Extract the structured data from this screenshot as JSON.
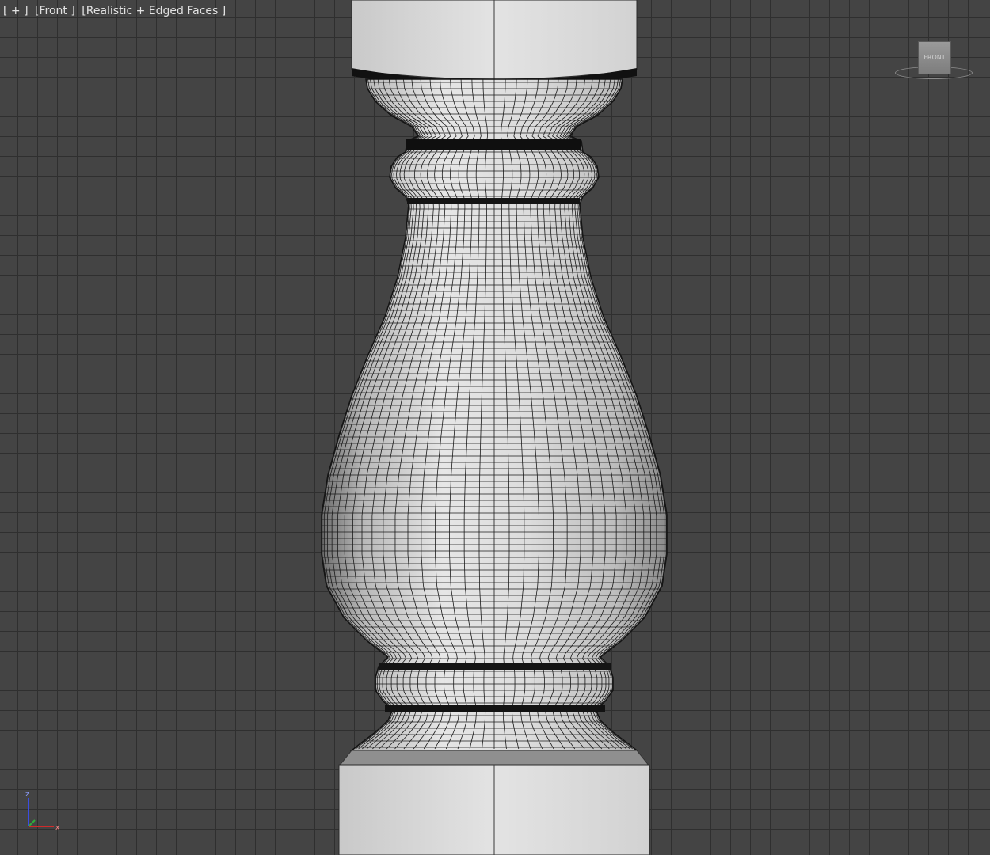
{
  "viewport": {
    "label_plus": "[ + ]",
    "label_view": "[Front ]",
    "label_shading": "[Realistic + Edged Faces ]"
  },
  "viewcube": {
    "face_label": "FRONT"
  },
  "axis_gizmo": {
    "z_label": "z",
    "x_label": "x"
  },
  "colors": {
    "viewport_bg": "#444444",
    "grid_line": "#2f2f2f",
    "model_light": "#ebebeb",
    "model_shadow": "#7a7a7a",
    "wire": "#1a1a1a",
    "axis_z": "#3b4de0",
    "axis_x": "#d02a2a"
  }
}
